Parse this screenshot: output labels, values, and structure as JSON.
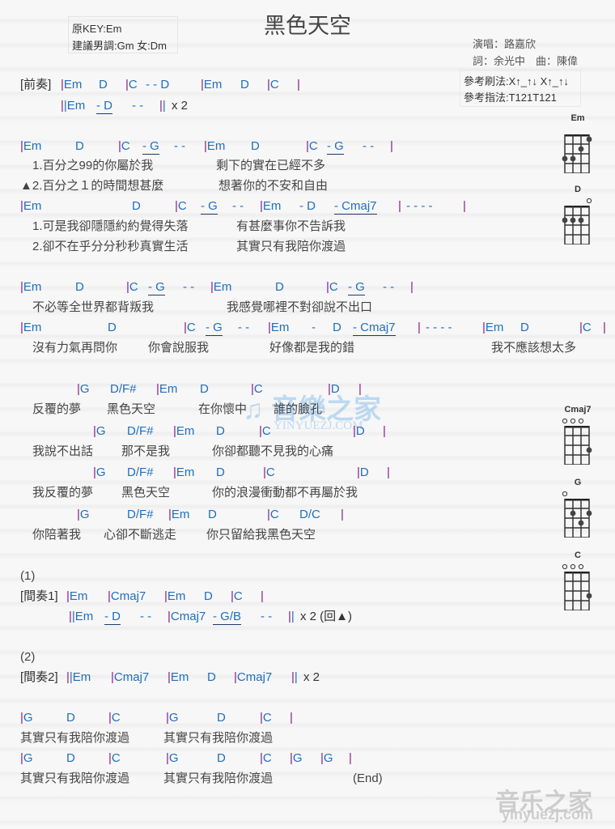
{
  "header": {
    "title": "黑色天空",
    "original_key": "原KEY:Em",
    "suggested_key": "建議男調:Gm 女:Dm",
    "singer": "演唱：路嘉欣",
    "writers": "詞：余光中　曲：陳偉",
    "strum": "參考刷法:X↑_↑↓ X↑_↑↓",
    "picking": "參考指法:T121T121"
  },
  "lines": [
    [
      "[前奏]",
      "|Em",
      "D",
      "|C",
      "- - D",
      "|Em",
      "D",
      "|C",
      "|"
    ],
    [
      "||Em",
      "- D",
      "- -",
      "||",
      "x 2"
    ],
    [
      "|Em",
      "D",
      "|C",
      "- G",
      "- -",
      "|Em",
      "D",
      "|C",
      "- G",
      "- -",
      "|"
    ],
    [
      "1.百分之99的你屬於我",
      "剩下的實在已經不多"
    ],
    [
      "▲2.百分之１的時間想甚麼",
      "想著你的不安和自由"
    ],
    [
      "|Em",
      "D",
      "|C",
      "- G",
      "- -",
      "|Em",
      "- D",
      "- Cmaj7",
      "|",
      "- - - -",
      "|"
    ],
    [
      "1.可是我卻隱隱約約覺得失落",
      "有甚麼事你不告訴我"
    ],
    [
      "2.卻不在乎分分秒秒真實生活",
      "其實只有我陪你渡過"
    ],
    [
      "|Em",
      "D",
      "|C",
      "- G",
      "- -",
      "|Em",
      "D",
      "|C",
      "- G",
      "- -",
      "|"
    ],
    [
      "不必等全世界都背叛我",
      "我感覺哪裡不對卻說不出口"
    ],
    [
      "|Em",
      "D",
      "|C",
      "- G",
      "- -",
      "|Em",
      "-",
      "D",
      "- Cmaj7",
      "|",
      "- - - -",
      "|Em",
      "D",
      "|C",
      "|"
    ],
    [
      "沒有力氣再問你",
      "你會說服我",
      "好像都是我的錯",
      "我不應該想太多"
    ],
    [
      "|G",
      "D/F#",
      "|Em",
      "D",
      "|C",
      "|D",
      "|"
    ],
    [
      "反覆的夢",
      "黑色天空",
      "在你懷中",
      "誰的臉孔"
    ],
    [
      "|G",
      "D/F#",
      "|Em",
      "D",
      "|C",
      "|D",
      "|"
    ],
    [
      "我說不出話",
      "那不是我",
      "你卻都聽不見我的心痛"
    ],
    [
      "|G",
      "D/F#",
      "|Em",
      "D",
      "|C",
      "|D",
      "|"
    ],
    [
      "我反覆的夢",
      "黑色天空",
      "你的浪漫衝動都不再屬於我"
    ],
    [
      "|G",
      "D/F#",
      "|Em",
      "D",
      "|C",
      "D/C",
      "|"
    ],
    [
      "你陪著我",
      "心卻不斷逃走",
      "你只留給我黑色天空"
    ],
    [
      "(1)"
    ],
    [
      "[間奏1]",
      "|Em",
      "|Cmaj7",
      "|Em",
      "D",
      "|C",
      "|"
    ],
    [
      "||Em",
      "- D",
      "- -",
      "|Cmaj7",
      "- G/B",
      "- -",
      "||",
      "x 2 (回▲)"
    ],
    [
      "(2)"
    ],
    [
      "[間奏2]",
      "||Em",
      "|Cmaj7",
      "|Em",
      "D",
      "|Cmaj7",
      "||",
      "x 2"
    ],
    [
      "|G",
      "D",
      "|C",
      "|G",
      "D",
      "|C",
      "|"
    ],
    [
      "其實只有我陪你渡過",
      "其實只有我陪你渡過"
    ],
    [
      "|G",
      "D",
      "|C",
      "|G",
      "D",
      "|C",
      "|G",
      "|G",
      "|"
    ],
    [
      "其實只有我陪你渡過",
      "其實只有我陪你渡過",
      "(End)"
    ]
  ],
  "chord_diagrams": [
    {
      "name": "Em",
      "open": []
    },
    {
      "name": "D",
      "open": [
        4
      ]
    },
    {
      "name": "Cmaj7",
      "open": [
        1,
        2,
        3
      ]
    },
    {
      "name": "G",
      "open": [
        1
      ]
    },
    {
      "name": "C",
      "open": [
        1,
        2,
        3
      ]
    }
  ],
  "colors": {
    "bar": "#8a1f8a",
    "chord": "#1e6fbf",
    "text": "#333333"
  },
  "watermark": {
    "logo": "音樂之家",
    "url": "YINYUEZJ.COM",
    "corner_logo": "音乐之家",
    "corner_url": "yinyuezj.com"
  }
}
